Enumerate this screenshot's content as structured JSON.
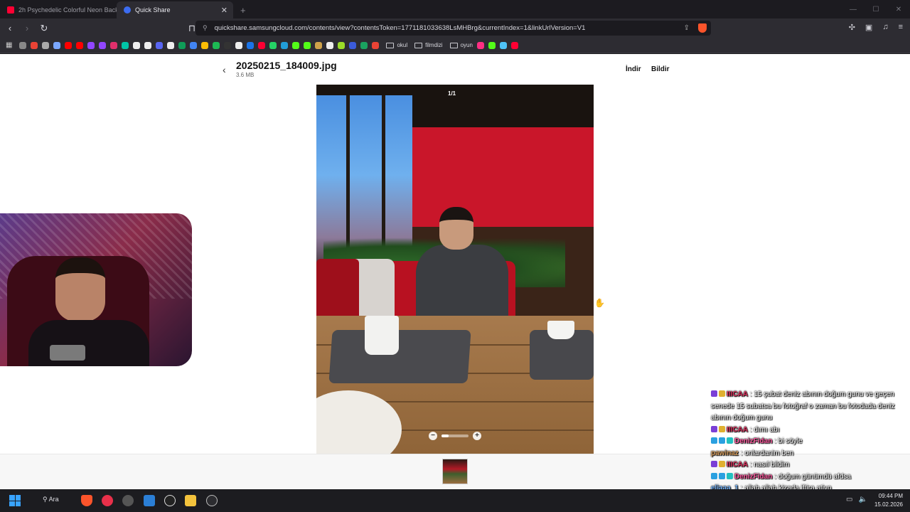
{
  "tabs": [
    {
      "label": "2h Psychedelic Colorful Neon Backgr",
      "favicon_color": "#ff0033"
    },
    {
      "label": "Quick Share",
      "favicon_color": "#3c6cf0"
    }
  ],
  "new_tab_label": "+",
  "address_bar": {
    "url": "quickshare.samsungcloud.com/contents/view?contentsToken=1771181033638LsMHBrg&currentIndex=1&linkUrlVersion=V1"
  },
  "bookmarks": {
    "icon_colors": [
      "#888",
      "#ea4335",
      "#aaa",
      "#7aa7ff",
      "#ff0000",
      "#ff0000",
      "#9146ff",
      "#9146ff",
      "#e1306c",
      "#00c4a7",
      "#eee",
      "#eee",
      "#5865f2",
      "#eee",
      "#0f9d58",
      "#4285f4",
      "#fbbc05",
      "#1db954",
      "#333",
      "#eee",
      "#1a73e8",
      "#ff0033",
      "#25d366",
      "#229ed9",
      "#53fc18",
      "#53fc18",
      "#cfa24a",
      "#eee",
      "#9bdc28",
      "#3b5bdb",
      "#1aa260",
      "#ea4335"
    ],
    "folders": [
      "okul",
      "filmdizi",
      "oyun"
    ],
    "trailing_icon_colors": [
      "#ff2e83",
      "#53fc18",
      "#4fc3f7",
      "#ff0033"
    ]
  },
  "viewer": {
    "file_name": "20250215_184009.jpg",
    "file_size": "3.6 MB",
    "download_label": "İndir",
    "report_label": "Bildir",
    "counter": "1/1",
    "zoom_level": 0.25,
    "zoom_out": "−",
    "zoom_in": "+"
  },
  "chat": {
    "messages": [
      {
        "user": "IIICAA",
        "user_color": "#e0315f",
        "badges": [
          "#7a3fd6",
          "#e0b030"
        ],
        "text": ": 15 şubat deniz abının doğum gunu ve geçen senede 15 subatsa bu fotoğraf o zaman bu fotodada deniz abının doğum gunu"
      },
      {
        "user": "IIICAA",
        "user_color": "#e0315f",
        "badges": [
          "#7a3fd6",
          "#e0b030"
        ],
        "text": ": dımı abı"
      },
      {
        "user": "DenizFidan",
        "user_color": "#ff5aa0",
        "badges": [
          "#2aa0e0",
          "#2aa0e0",
          "#22c0c0"
        ],
        "text": ": bi söyle"
      },
      {
        "user": "pawinaz",
        "user_color": "#d9a060",
        "badges": [],
        "text": ": onlardanim ben"
      },
      {
        "user": "IIICAA",
        "user_color": "#e0315f",
        "badges": [
          "#7a3fd6",
          "#e0b030"
        ],
        "text": ": nasıl bildim"
      },
      {
        "user": "DenizFidan",
        "user_color": "#ff5aa0",
        "badges": [
          "#2aa0e0",
          "#2aa0e0",
          "#22c0c0"
        ],
        "text": ": doğum günümdü afdsa"
      },
      {
        "user": "eliaaa_1",
        "user_color": "#7ab8ff",
        "badges": [],
        "text": ": allah allah kizada iftira atiyo"
      }
    ]
  },
  "taskbar": {
    "search_label": "Ara",
    "time": "09:44 PM",
    "date": "15.02.2026"
  }
}
